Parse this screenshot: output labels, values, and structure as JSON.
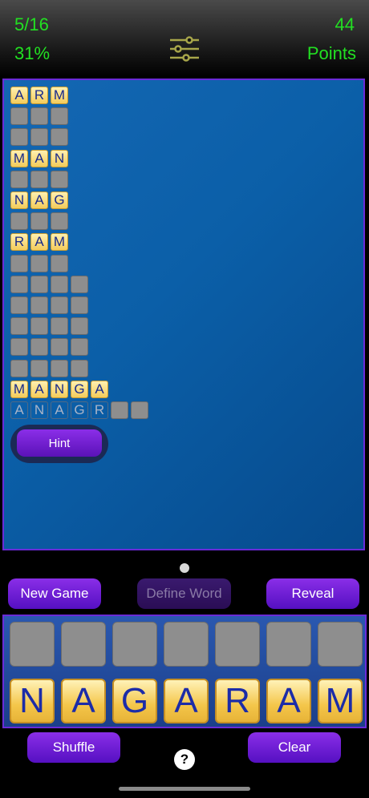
{
  "header": {
    "progress": "5/16",
    "percent": "31%",
    "points_value": "44",
    "points_label": "Points",
    "text_color": "#22e022",
    "settings_icon": "sliders-icon"
  },
  "board": {
    "words": [
      {
        "letters": [
          "A",
          "R",
          "M"
        ],
        "state": "found"
      },
      {
        "letters": [
          "",
          "",
          ""
        ],
        "state": "empty"
      },
      {
        "letters": [
          "",
          "",
          ""
        ],
        "state": "empty"
      },
      {
        "letters": [
          "M",
          "A",
          "N"
        ],
        "state": "found"
      },
      {
        "letters": [
          "",
          "",
          ""
        ],
        "state": "empty"
      },
      {
        "letters": [
          "N",
          "A",
          "G"
        ],
        "state": "found"
      },
      {
        "letters": [
          "",
          "",
          ""
        ],
        "state": "empty"
      },
      {
        "letters": [
          "R",
          "A",
          "M"
        ],
        "state": "found"
      },
      {
        "letters": [
          "",
          "",
          ""
        ],
        "state": "empty"
      },
      {
        "letters": [
          "",
          "",
          "",
          ""
        ],
        "state": "empty"
      },
      {
        "letters": [
          "",
          "",
          "",
          ""
        ],
        "state": "empty"
      },
      {
        "letters": [
          "",
          "",
          "",
          ""
        ],
        "state": "empty"
      },
      {
        "letters": [
          "",
          "",
          "",
          ""
        ],
        "state": "empty"
      },
      {
        "letters": [
          "",
          "",
          "",
          ""
        ],
        "state": "empty"
      },
      {
        "letters": [
          "M",
          "A",
          "N",
          "G",
          "A"
        ],
        "state": "found"
      },
      {
        "letters": [
          "A",
          "N",
          "A",
          "G",
          "R",
          "",
          ""
        ],
        "state": "hint"
      }
    ],
    "hint_label": "Hint"
  },
  "controls": {
    "new_game_label": "New Game",
    "define_word_label": "Define Word",
    "reveal_label": "Reveal",
    "shuffle_label": "Shuffle",
    "clear_label": "Clear",
    "help_symbol": "?"
  },
  "rack": {
    "slots": 7,
    "letters": [
      "N",
      "A",
      "G",
      "A",
      "R",
      "A",
      "M"
    ]
  },
  "colors": {
    "accent_purple": "#7a22d8",
    "tile_gold": "#f4c64a",
    "tile_text": "#1c2ca8",
    "board_blue": "#0b5fa8"
  }
}
